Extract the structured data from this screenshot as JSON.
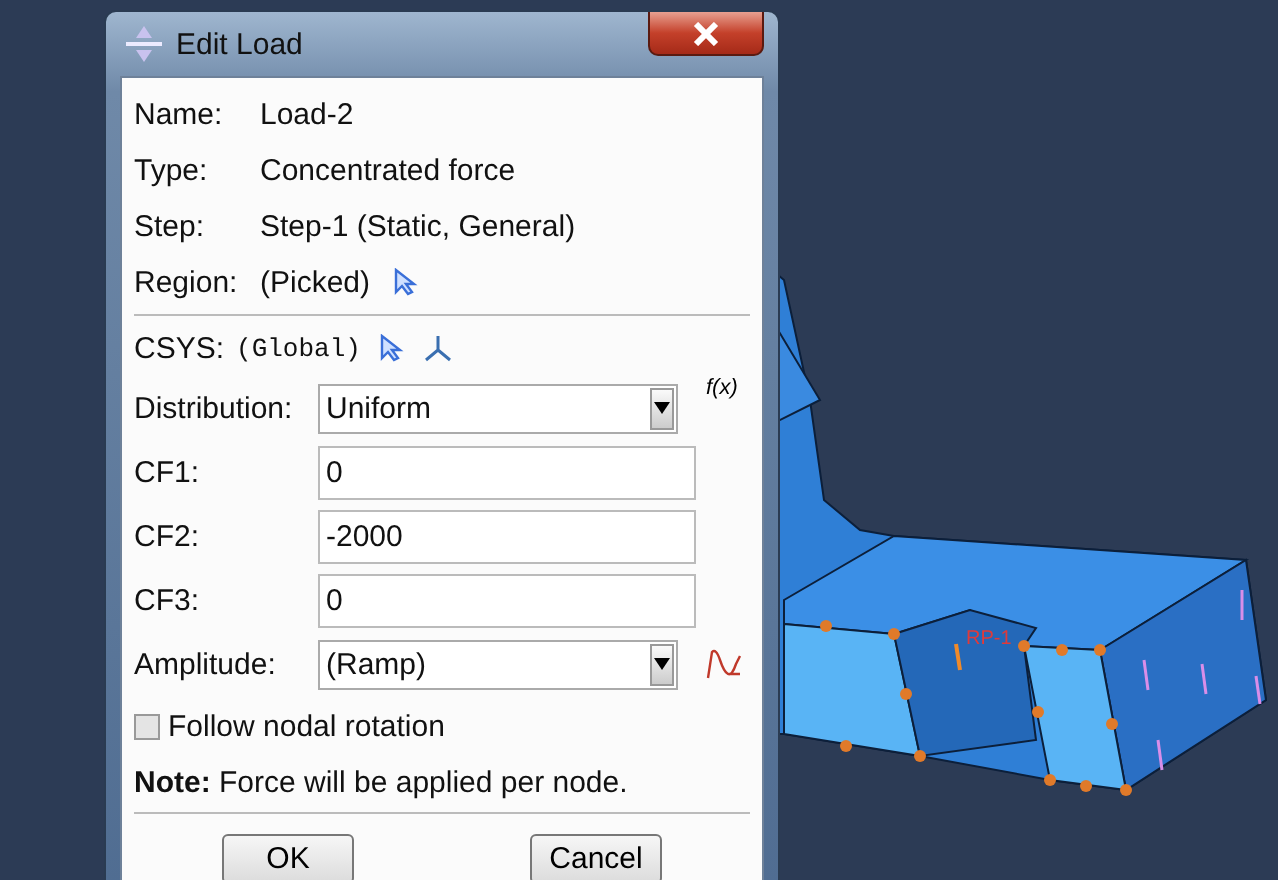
{
  "window": {
    "title": "Edit Load"
  },
  "info": [
    {
      "kind": "plain",
      "label": "Name:",
      "value": "Load-2"
    },
    {
      "kind": "plain",
      "label": "Type:",
      "value": "Concentrated force"
    },
    {
      "kind": "plain",
      "label": "Step:",
      "value": "Step-1 (Static, General)"
    },
    {
      "kind": "pick",
      "label": "Region:",
      "value": "(Picked)"
    }
  ],
  "csys": {
    "label": "CSYS:",
    "value": "(Global)"
  },
  "fields": [
    {
      "kind": "dropdown",
      "label": "Distribution:",
      "value": "Uniform",
      "accessory": {
        "kind": "fx",
        "text": "f(x)"
      }
    },
    {
      "kind": "text",
      "label": "CF1:",
      "value": "0"
    },
    {
      "kind": "text",
      "label": "CF2:",
      "value": "-2000"
    },
    {
      "kind": "text",
      "label": "CF3:",
      "value": "0"
    },
    {
      "kind": "dropdown",
      "label": "Amplitude:",
      "value": "(Ramp)",
      "accessory": {
        "kind": "wave"
      }
    }
  ],
  "follow_nodal_rotation": {
    "label": "Follow nodal rotation",
    "checked": false
  },
  "note": "**Note:** Force will be applied per node.",
  "buttons": [
    "OK",
    "Cancel"
  ],
  "viewport": {
    "point_label": "RP-1"
  }
}
